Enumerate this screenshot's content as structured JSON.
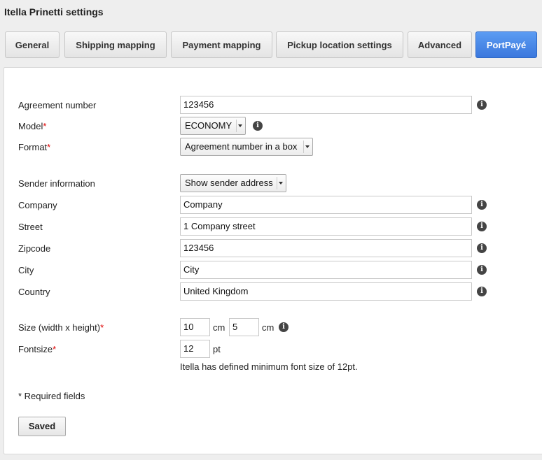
{
  "page": {
    "title": "Itella Prinetti settings"
  },
  "tabs": [
    {
      "label": "General"
    },
    {
      "label": "Shipping mapping"
    },
    {
      "label": "Payment mapping"
    },
    {
      "label": "Pickup location settings"
    },
    {
      "label": "Advanced"
    },
    {
      "label": "PortPayé"
    }
  ],
  "form": {
    "required_mark": "*",
    "agreement_number": {
      "label": "Agreement number",
      "value": "123456"
    },
    "model": {
      "label": "Model",
      "value": "ECONOMY"
    },
    "format": {
      "label": "Format",
      "value": "Agreement number in a box"
    },
    "sender_information": {
      "label": "Sender information",
      "value": "Show sender address"
    },
    "company": {
      "label": "Company",
      "value": "Company"
    },
    "street": {
      "label": "Street",
      "value": "1 Company street"
    },
    "zipcode": {
      "label": "Zipcode",
      "value": "123456"
    },
    "city": {
      "label": "City",
      "value": "City"
    },
    "country": {
      "label": "Country",
      "value": "United Kingdom"
    },
    "size": {
      "label": "Size (width x height)",
      "width": "10",
      "height": "5",
      "unit": "cm"
    },
    "fontsize": {
      "label": "Fontsize",
      "value": "12",
      "unit": "pt",
      "note": "Itella has defined minimum font size of 12pt."
    },
    "required_note": "* Required fields",
    "save_label": "Saved"
  },
  "icons": {
    "info": "info-icon",
    "caret": "chevron-down-icon"
  },
  "colors": {
    "active_tab": "#3b78dd",
    "required": "#dd0000"
  }
}
